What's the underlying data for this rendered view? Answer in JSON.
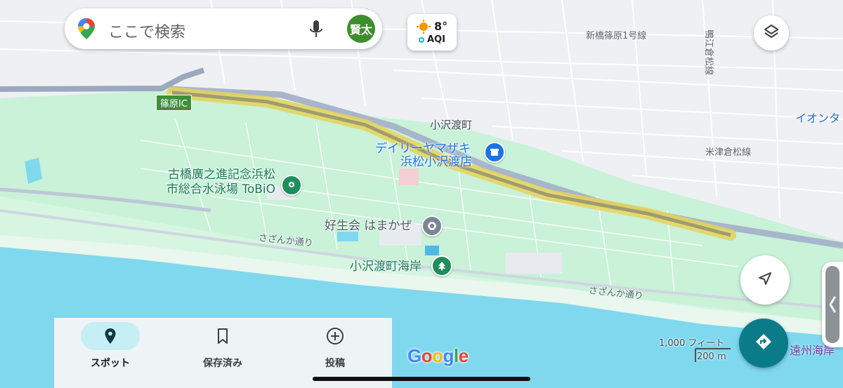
{
  "search": {
    "placeholder": "ここで検索",
    "avatar_text": "賢太"
  },
  "weather": {
    "temperature": "8°",
    "aqi_label": "AQI"
  },
  "map": {
    "area_labels": [
      "小沢渡町"
    ],
    "road_labels": [
      "さざんか通り",
      "さざんか通り",
      "新橋篠原1号線",
      "新橋篠原1号線",
      "米津倉松線",
      "鴨江倉松線"
    ],
    "ic_badge": "篠原IC",
    "edge_label": "イオンタ",
    "coast_label": "遠州海岸",
    "pois": [
      {
        "name_line1": "古橋廣之進記念浜松",
        "name_line2": "市総合水泳場 ToBiO",
        "icon": "pin-icon",
        "color": "#1e8e5a"
      },
      {
        "name_line1": "デイリーヤマザキ",
        "name_line2": "浜松小沢渡店",
        "icon": "shop-icon",
        "color": "#1a73e8"
      },
      {
        "name_line1": "好生会 はまかぜ",
        "name_line2": "",
        "icon": "circle-icon",
        "color": "#7b8794"
      },
      {
        "name_line1": "小沢渡町海岸",
        "name_line2": "",
        "icon": "tree-icon",
        "color": "#1e8e5a"
      }
    ]
  },
  "scale": {
    "feet": "1,000 フィート",
    "meters": "200 m"
  },
  "nav": {
    "items": [
      {
        "label": "スポット",
        "icon": "location-pin-icon",
        "selected": true
      },
      {
        "label": "保存済み",
        "icon": "bookmark-icon",
        "selected": false
      },
      {
        "label": "投稿",
        "icon": "add-circle-icon",
        "selected": false
      }
    ]
  },
  "brand": {
    "logo": "Google"
  },
  "colors": {
    "route_highlight": "#e6d25a",
    "accent": "#0b7b8a",
    "sea": "#7fd8ee",
    "park": "#c9f2d8"
  }
}
